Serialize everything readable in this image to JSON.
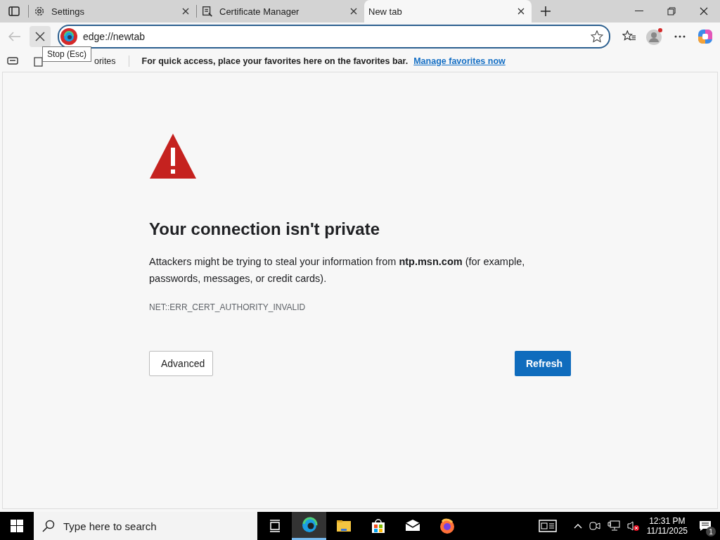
{
  "tabs": [
    {
      "title": "Settings",
      "kind": "settings",
      "selected": false
    },
    {
      "title": "Certificate Manager",
      "kind": "certificate",
      "selected": false
    },
    {
      "title": "New tab",
      "kind": "none",
      "selected": true
    }
  ],
  "address_bar": {
    "url": "edge://newtab"
  },
  "tooltip": "Stop (Esc)",
  "favorites_bar": {
    "import_label": "orites",
    "message": "For quick access, place your favorites here on the favorites bar.",
    "link": "Manage favorites now"
  },
  "error_page": {
    "title": "Your connection isn't private",
    "description": "Attackers might be trying to steal your information from **ntp.msn.com** (for example, passwords, messages, or credit cards).",
    "error_code": "NET::ERR_CERT_AUTHORITY_INVALID",
    "buttons": [
      {
        "label": "Advanced",
        "kind": "secondary"
      },
      {
        "label": "Refresh",
        "kind": "primary"
      }
    ]
  },
  "taskbar": {
    "search_placeholder": "Type here to search",
    "apps": [
      {
        "kind": "task-view",
        "selected": false
      },
      {
        "kind": "edge",
        "selected": true
      },
      {
        "kind": "folder",
        "selected": false
      },
      {
        "kind": "store",
        "selected": false
      },
      {
        "kind": "mail",
        "selected": false
      },
      {
        "kind": "firefox",
        "selected": false
      }
    ],
    "time": "12:31 PM",
    "date": "11/11/2025",
    "notification_count": "1"
  }
}
